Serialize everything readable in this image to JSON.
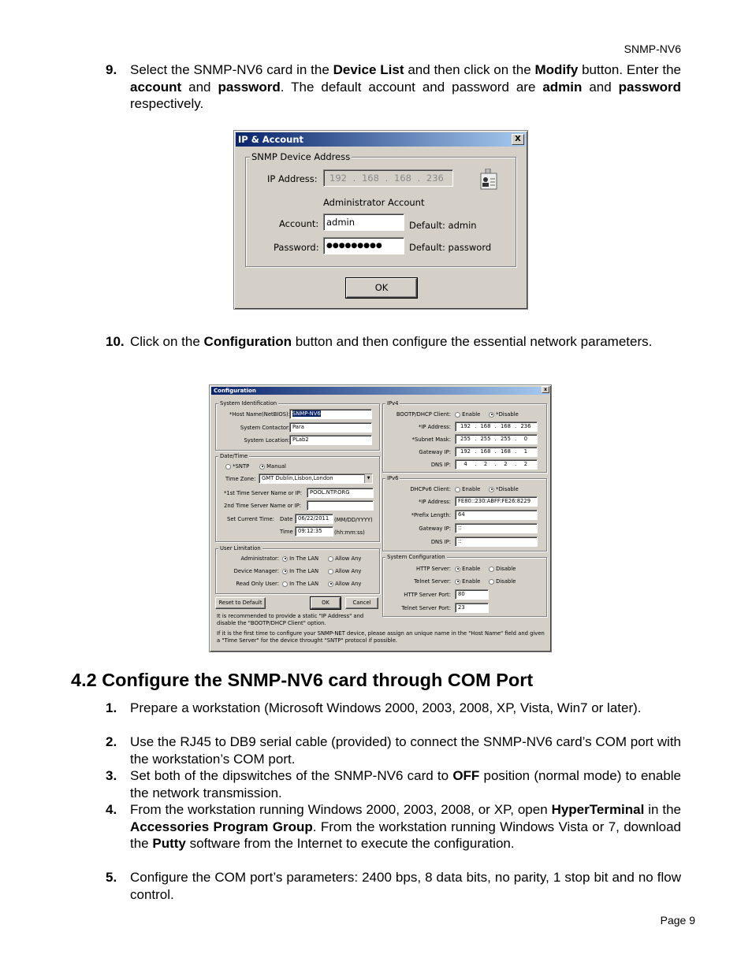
{
  "header": {
    "doc_title": "SNMP-NV6"
  },
  "footer": {
    "page": "Page 9"
  },
  "step9": {
    "num": "9.",
    "t1": "Select the SNMP-NV6 card in the ",
    "b1": "Device List",
    "t2": " and then click on the ",
    "b2": "Modify",
    "t3": " button. Enter the ",
    "b3": "account",
    "t4": " and ",
    "b4": "password",
    "t5": ". The default account and password are ",
    "b5": "admin",
    "t6": " and ",
    "b6": "password",
    "t7": " respectively."
  },
  "ip_dialog": {
    "title": "IP & Account",
    "close": "X",
    "group_label": "SNMP Device Address",
    "ip_label": "IP Address:",
    "ip": [
      "192",
      "168",
      "168",
      "236"
    ],
    "admin_heading": "Administrator Account",
    "account_label": "Account:",
    "account_value": "admin",
    "account_default": "Default: admin",
    "password_label": "Password:",
    "password_value": "●●●●●●●●●",
    "password_default": "Default: password",
    "ok": "OK",
    "icon": "id-card-icon"
  },
  "step10": {
    "num": "10.",
    "t1": "Click on the ",
    "b1": "Configuration",
    "t2": " button and then configure the essential network parameters."
  },
  "config_dialog": {
    "title": "Configuration",
    "close": "x",
    "sysid": {
      "label": "System Identification",
      "host_label": "*Host Name(NetBIOS):",
      "host_value": "SNMP-NV6",
      "contact_label": "System Contactor:",
      "contact_value": "Para",
      "location_label": "System Location:",
      "location_value": "PLab2"
    },
    "datetime": {
      "label": "Date/Time",
      "sntp": "*SNTP",
      "manual": "Manual",
      "mode_selected": "Manual",
      "tz_label": "Time Zone:",
      "tz_value": "GMT Dublin,Lisbon,London",
      "ts1_label": "*1st Time Server Name or IP:",
      "ts1_value": "POOL.NTP.ORG",
      "ts2_label": "2nd Time Server Name or IP:",
      "ts2_value": "",
      "set_label": "Set Current Time:",
      "date_label": "Date",
      "date_value": "06/22/2011",
      "date_fmt": "(MM/DD/YYYY)",
      "time_label": "Time",
      "time_value": "09:12:35",
      "time_fmt": "(hh:mm:ss)"
    },
    "userlim": {
      "label": "User Limitation",
      "opt_lan": "In The LAN",
      "opt_any": "Allow Any",
      "rows": [
        {
          "label": "Administrator:",
          "selected": "lan"
        },
        {
          "label": "Device Manager:",
          "selected": "lan"
        },
        {
          "label": "Read Only User:",
          "selected": "any"
        }
      ]
    },
    "buttons": {
      "reset": "Reset to Default",
      "ok": "OK",
      "cancel": "Cancel"
    },
    "ipv4": {
      "label": "IPv4",
      "dhcp_label": "BOOTP/DHCP Client:",
      "enable": "Enable",
      "disable": "*Disable",
      "dhcp_selected": "disable",
      "ip_label": "*IP Address:",
      "ip": [
        "192",
        "168",
        "168",
        "236"
      ],
      "mask_label": "*Subnet Mask:",
      "mask": [
        "255",
        "255",
        "255",
        "0"
      ],
      "gw_label": "Gateway IP:",
      "gw": [
        "192",
        "168",
        "168",
        "1"
      ],
      "dns_label": "DNS IP:",
      "dns": [
        "4",
        "2",
        "2",
        "2"
      ]
    },
    "ipv6": {
      "label": "IPv6",
      "dhcp_label": "DHCPv6 Client:",
      "enable": "Enable",
      "disable": "*Disable",
      "dhcp_selected": "disable",
      "ip_label": "*IP Address:",
      "ip_value": "FE80::230:ABFF:FE26:8229",
      "prefix_label": "*Prefix Length:",
      "prefix_value": "64",
      "gw_label": "Gateway IP:",
      "gw_value": "::",
      "dns_label": "DNS IP:",
      "dns_value": "::"
    },
    "syscfg": {
      "label": "System Configuration",
      "http_label": "HTTP Server:",
      "telnet_label": "Telnet Server:",
      "enable": "Enable",
      "disable": "Disable",
      "http_selected": "enable",
      "telnet_selected": "enable",
      "http_port_label": "HTTP Server Port:",
      "http_port": "80",
      "telnet_port_label": "Telnet Server Port:",
      "telnet_port": "23"
    },
    "note1": "It is recommended to provide a static \"IP Address\" and disable the \"BOOTP/DHCP Client\" option.",
    "note2": "If it is the first time to configure your SNMP-NET device, please assign an unique name in the \"Host Name\" field and given a \"Time Server\" for the device throught \"SNTP\" protocol if possible."
  },
  "section": {
    "heading": "4.2 Configure the SNMP-NV6 card through COM Port"
  },
  "steps": {
    "s1": {
      "num": "1.",
      "text": "Prepare a workstation (Microsoft Windows 2000, 2003, 2008, XP, Vista, Win7 or later)."
    },
    "s2": {
      "num": "2.",
      "text": "Use the RJ45 to DB9 serial cable (provided) to connect the SNMP-NV6 card’s COM port with the workstation’s COM port."
    },
    "s3": {
      "num": "3.",
      "t1": "Set both of the dipswitches of the SNMP-NV6 card to ",
      "b1": "OFF",
      "t2": " position (normal mode) to enable the network transmission."
    },
    "s4": {
      "num": "4.",
      "t1": "From the workstation running Windows 2000, 2003, 2008, or XP, open ",
      "b1": "HyperTerminal",
      "t2": " in the ",
      "b2": "Accessories Program Group",
      "t3": ". From the workstation running Windows Vista or 7, download the ",
      "b3": "Putty",
      "t4": " software from the Internet to execute the configuration."
    },
    "s5": {
      "num": "5.",
      "text": "Configure the COM port’s parameters:  2400 bps, 8 data bits, no parity, 1 stop bit and no flow control."
    }
  }
}
